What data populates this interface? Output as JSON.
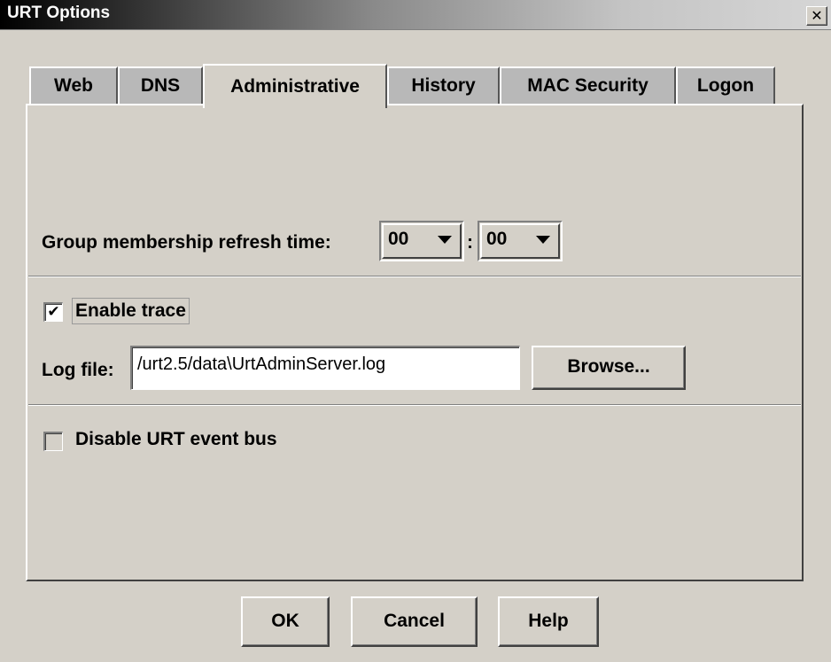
{
  "window": {
    "title": "URT Options",
    "close_glyph": "✕"
  },
  "tabs": [
    {
      "label": "Web",
      "active": false
    },
    {
      "label": "DNS",
      "active": false
    },
    {
      "label": "Administrative",
      "active": true
    },
    {
      "label": "History",
      "active": false
    },
    {
      "label": "MAC Security",
      "active": false
    },
    {
      "label": "Logon",
      "active": false
    }
  ],
  "refresh": {
    "label": "Group membership refresh time:",
    "hours": "00",
    "separator": ":",
    "minutes": "00"
  },
  "trace": {
    "label": "Enable trace",
    "checked": true,
    "check_glyph": "✔"
  },
  "logfile": {
    "label": "Log file:",
    "value": "/urt2.5/data\\UrtAdminServer.log",
    "browse_label": "Browse..."
  },
  "eventbus": {
    "label": "Disable URT event bus",
    "checked": false
  },
  "buttons": {
    "ok": "OK",
    "cancel": "Cancel",
    "help": "Help"
  },
  "colors": {
    "face": "#d4d0c8",
    "inactive_tab": "#b8b8b8",
    "title_start": "#000000",
    "title_end": "#d6d6d6"
  }
}
